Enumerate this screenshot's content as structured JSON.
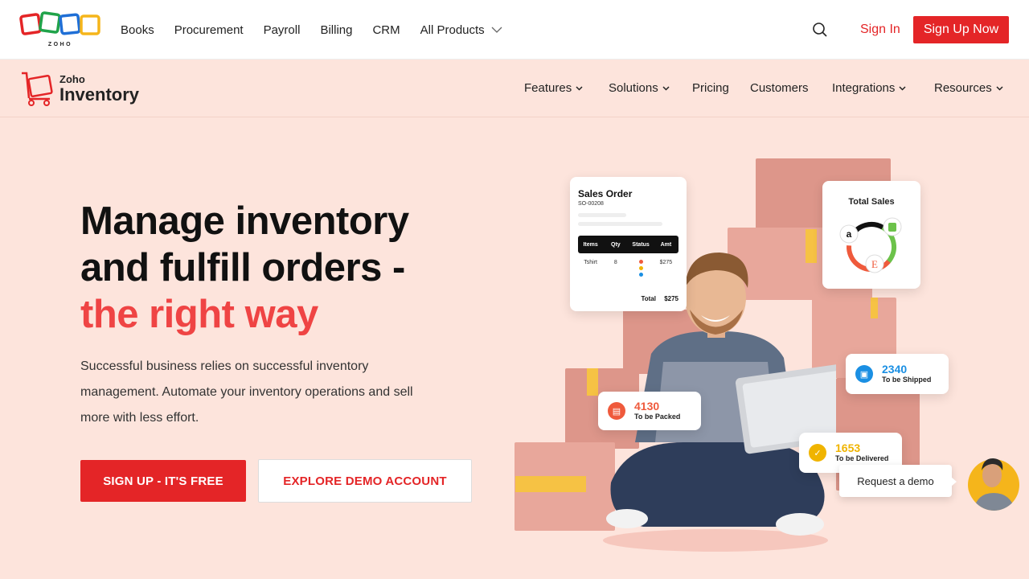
{
  "topbar": {
    "brand_logo_text": "ZOHO",
    "nav": [
      "Books",
      "Procurement",
      "Payroll",
      "Billing",
      "CRM",
      "All Products"
    ],
    "sign_in": "Sign In",
    "sign_up": "Sign Up Now"
  },
  "product_nav": {
    "logo_small": "Zoho",
    "logo_big": "Inventory",
    "links": [
      "Features",
      "Solutions",
      "Pricing",
      "Customers",
      "Integrations",
      "Resources"
    ]
  },
  "hero": {
    "title_line1": "Manage inventory",
    "title_line2": "and fulfill orders -",
    "title_accent": "the right way",
    "description": "Successful business relies on successful inventory management. Automate your inventory operations and sell more with less effort.",
    "cta_primary": "SIGN UP - IT'S FREE",
    "cta_secondary": "EXPLORE DEMO ACCOUNT"
  },
  "sales_order_card": {
    "title": "Sales Order",
    "number": "SO-00208",
    "headers": [
      "Items",
      "Qty",
      "Status",
      "Amt"
    ],
    "row": {
      "item": "Tshirt",
      "qty": "8",
      "amt": "$275"
    },
    "total_label": "Total",
    "total_value": "$275"
  },
  "total_sales_card": {
    "title": "Total Sales",
    "channels": [
      "a",
      "E"
    ]
  },
  "stats": {
    "shipped": {
      "value": "2340",
      "label": "To be Shipped"
    },
    "packed": {
      "value": "4130",
      "label": "To be Packed"
    },
    "delivered": {
      "value": "1653",
      "label": "To be Delivered"
    }
  },
  "demo_widget": {
    "label": "Request a demo"
  },
  "colors": {
    "accent": "#e42527",
    "hero_bg": "#fde4dc",
    "shipped": "#1a8fe3",
    "packed": "#ef5a3c",
    "delivered": "#f0b400"
  }
}
